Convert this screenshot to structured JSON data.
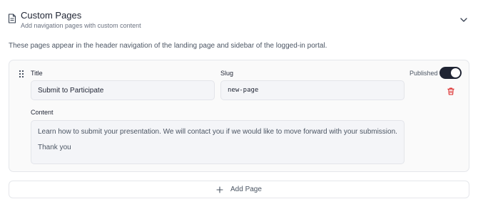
{
  "section": {
    "title": "Custom Pages",
    "subtitle": "Add navigation pages with custom content",
    "icon": "document-icon",
    "collapse_icon": "chevron-down-icon"
  },
  "description": "These pages appear in the header navigation of the landing page and sidebar of the logged-in portal.",
  "page": {
    "title_label": "Title",
    "title_value": "Submit to Participate",
    "slug_label": "Slug",
    "slug_value": "new-page",
    "content_label": "Content",
    "content_lines": [
      "Learn how to submit your presentation. We will contact you if we would like to move forward with your submission.",
      "Thank you"
    ],
    "published_label": "Published",
    "published": true,
    "drag_icon": "drag-handle-icon",
    "delete_icon": "trash-icon"
  },
  "add_page": {
    "label": "Add Page",
    "icon": "plus-icon"
  },
  "colors": {
    "toggle_on": "#1f2433",
    "delete": "#dc2626",
    "input_bg": "#f4f5f8",
    "border": "#e5e7eb"
  }
}
